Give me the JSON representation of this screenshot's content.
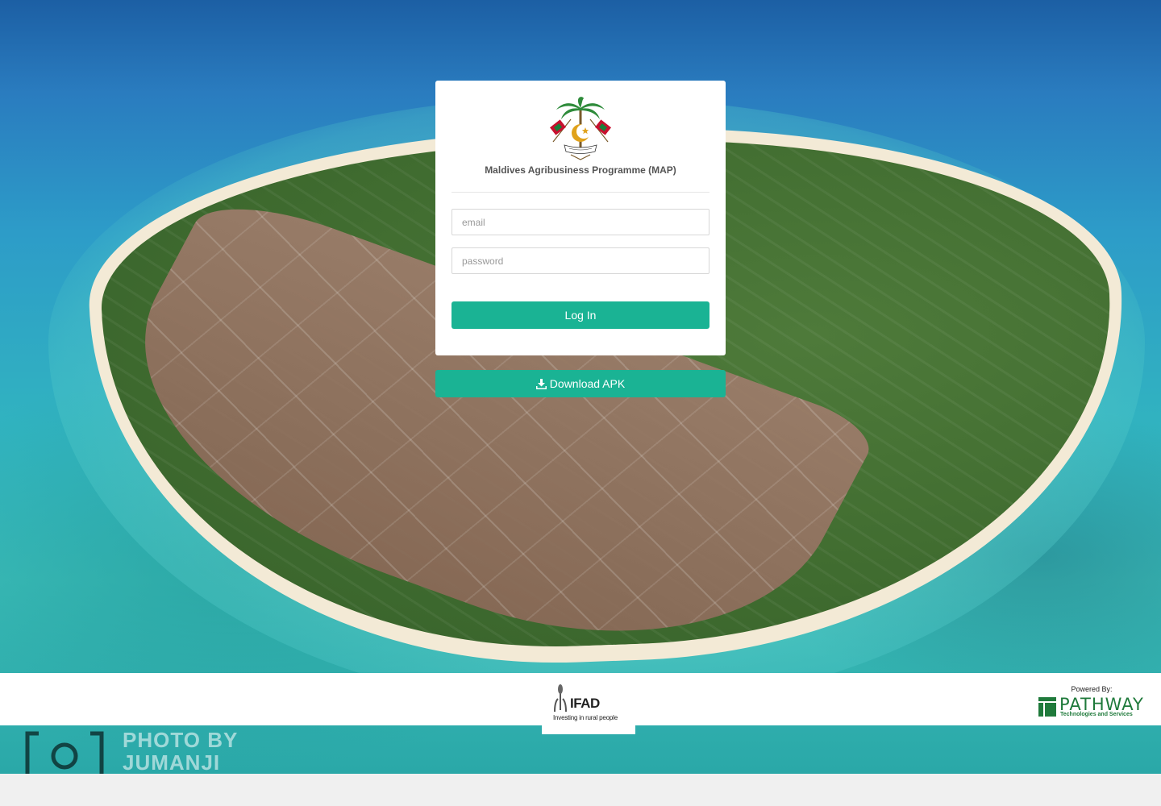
{
  "header": {
    "program_title": "Maldives Agribusiness Programme (MAP)"
  },
  "login_form": {
    "email_placeholder": "email",
    "password_placeholder": "password",
    "login_label": "Log In"
  },
  "download": {
    "label": "Download APK",
    "icon": "download-icon"
  },
  "footer": {
    "ifad": {
      "name": "IFAD",
      "tagline": "Investing in rural people"
    },
    "powered_by": "Powered By:",
    "pathway": {
      "name": "PATHWAY",
      "tagline": "Technologies and Services"
    }
  },
  "watermark": {
    "line1": "PHOTO BY",
    "line2": "JUMANJI"
  },
  "colors": {
    "primary": "#1ab394",
    "card_background": "#ffffff",
    "pathway_green": "#1f7a3b"
  }
}
